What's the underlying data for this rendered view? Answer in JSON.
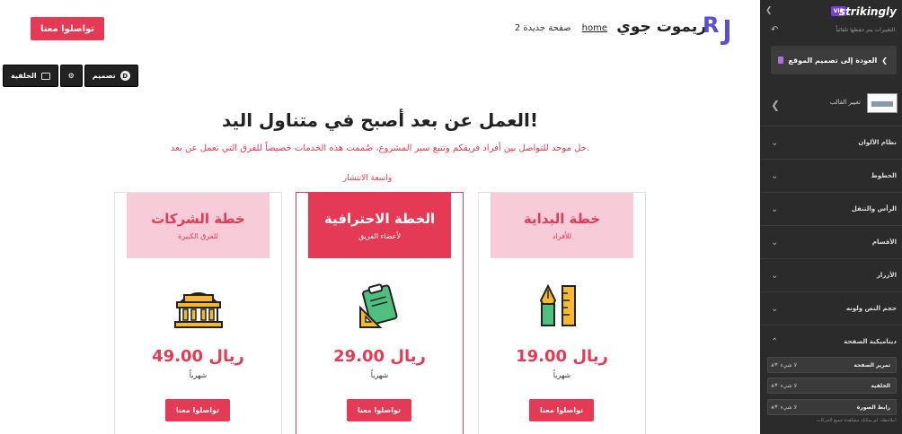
{
  "site": {
    "header_cta": "تواصلوا معنا",
    "nav": {
      "home": "home",
      "page2": "صفحة جديدة 2"
    },
    "brand": "ريموت جوي"
  },
  "section_controls": {
    "design": "تصميم",
    "background": "الخلفية"
  },
  "pricing": {
    "title": "العمل عن بعد أصبح في متناول اليد!",
    "subtitle": "حل موحد للتواصل بين أفراد فريقكم وتتبع سير المشروع، صُممت هذه الخدمات خصيصاً للفرق التي تعمل عن بعد.",
    "popular_label": "واسعة الانتشار",
    "plans": [
      {
        "name": "خطة الشركات",
        "audience": "للفرق الكبيرة",
        "price": "49.00 ريال",
        "period": "شهرياً",
        "cta": "تواصلوا معنا",
        "icon": "building-icon"
      },
      {
        "name": "الخطة الاحترافية",
        "audience": "لأعضاء الفريق",
        "price": "29.00 ريال",
        "period": "شهرياً",
        "cta": "تواصلوا معنا",
        "icon": "clipboard-tools-icon"
      },
      {
        "name": "خطة البداية",
        "audience": "للأفراد",
        "price": "19.00 ريال",
        "period": "شهرياً",
        "cta": "تواصلوا معنا",
        "icon": "pen-ruler-icon"
      }
    ]
  },
  "colors": {
    "accent": "#e53a56",
    "accent_light": "#f7cbd7",
    "sidebar_bg": "#2b2b2b",
    "vip": "#7b3fd6"
  },
  "sidebar": {
    "logo": "strikingly",
    "vip": "VIP",
    "autosave": "التغييرات يتم حفظها تلقائياً.",
    "back_button": "العودة إلى تصميم الموقع",
    "theme_label": "تغيير القالب",
    "sections": [
      "نظام الألوان",
      "الخطوط",
      "الرأس والتنقل",
      "الأقسام",
      "الأزرار",
      "حجم النص ولونه",
      "ديناميكية الصفحة"
    ],
    "fields": [
      {
        "label": "تمرير الصفحة",
        "value": "لا شيء"
      },
      {
        "label": "الخلفية",
        "value": "لا شيء"
      },
      {
        "label": "رابط الصورة",
        "value": "لا شيء"
      }
    ],
    "note": "ملاحظة: لم يمكنك مشاهدة جميع الحركات!"
  }
}
